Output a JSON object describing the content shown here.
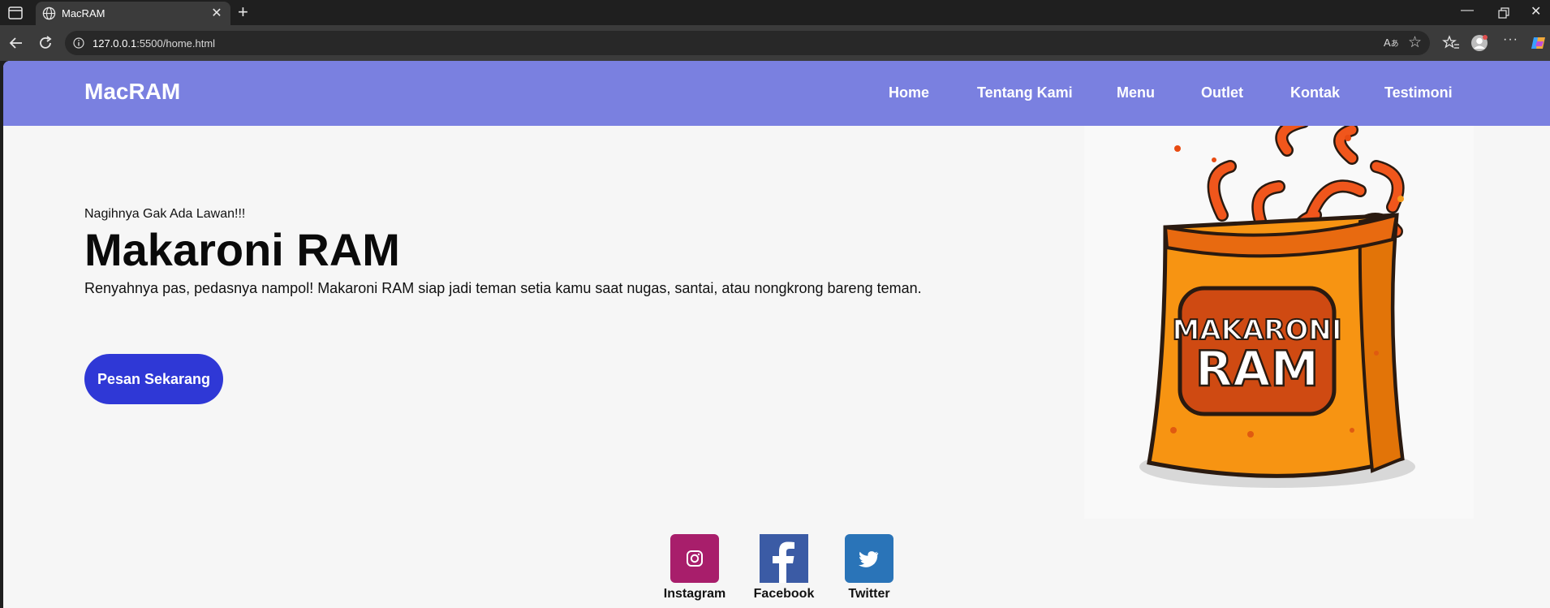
{
  "browser": {
    "tab_title": "MacRAM",
    "url_host": "127.0.0.1",
    "url_rest": ":5500/home.html",
    "icons": [
      "tab-actions-icon",
      "globe-icon",
      "close-icon",
      "plus-icon",
      "minimize-icon",
      "restore-icon",
      "window-close-icon",
      "back-icon",
      "reload-icon",
      "info-icon",
      "read-aloud-icon",
      "favorite-icon",
      "favorites-icon",
      "profile-icon",
      "more-icon",
      "copilot-icon"
    ]
  },
  "nav": {
    "brand": "MacRAM",
    "items": [
      "Home",
      "Tentang Kami",
      "Menu",
      "Outlet",
      "Kontak",
      "Testimoni"
    ],
    "bg": "#7a80e0"
  },
  "hero": {
    "tagline": "Nagihnya Gak Ada Lawan!!!",
    "title": "Makaroni RAM",
    "description": "Renyahnya pas, pedasnya nampol! Makaroni RAM siap jadi teman setia kamu saat nugas, santai, atau nongkrong bareng teman.",
    "cta": "Pesan Sekarang",
    "cta_color": "#2f38d6"
  },
  "product_image": {
    "bag_line1": "MAKARONI",
    "bag_line2": "RAM"
  },
  "social": [
    {
      "label": "Instagram",
      "color": "#a81e6b",
      "icon": "instagram-icon"
    },
    {
      "label": "Facebook",
      "color": "#3b5ba5",
      "icon": "facebook-icon"
    },
    {
      "label": "Twitter",
      "color": "#2a74b8",
      "icon": "twitter-icon"
    }
  ]
}
